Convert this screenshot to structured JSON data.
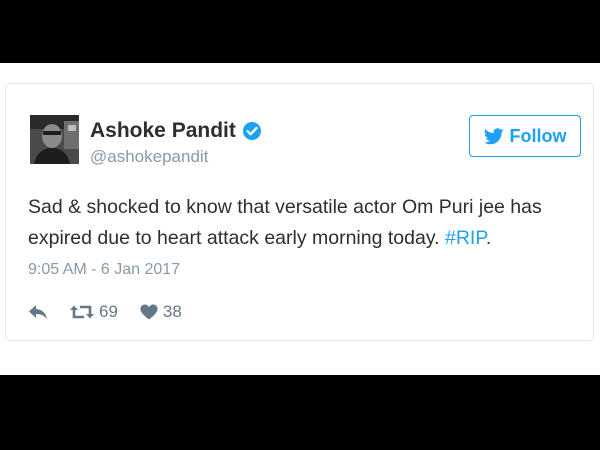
{
  "tweet": {
    "author": {
      "display_name": "Ashoke Pandit",
      "handle": "@ashokepandit",
      "verified": true
    },
    "follow_label": "Follow",
    "text_main": "Sad & shocked to know that versatile actor Om Puri jee has expired due to heart attack early morning today. ",
    "hashtag": "#RIP",
    "text_end": ".",
    "timestamp": "9:05 AM - 6 Jan 2017",
    "retweet_count": "69",
    "like_count": "38"
  },
  "icons": {
    "verified": "verified-badge-icon",
    "follow": "twitter-bird-icon",
    "reply": "reply-icon",
    "retweet": "retweet-icon",
    "like": "heart-icon"
  },
  "colors": {
    "accent": "#1da1f2",
    "text": "#292f33",
    "muted": "#8899a6",
    "border": "#e1e8ed",
    "letterbox": "#000000"
  }
}
